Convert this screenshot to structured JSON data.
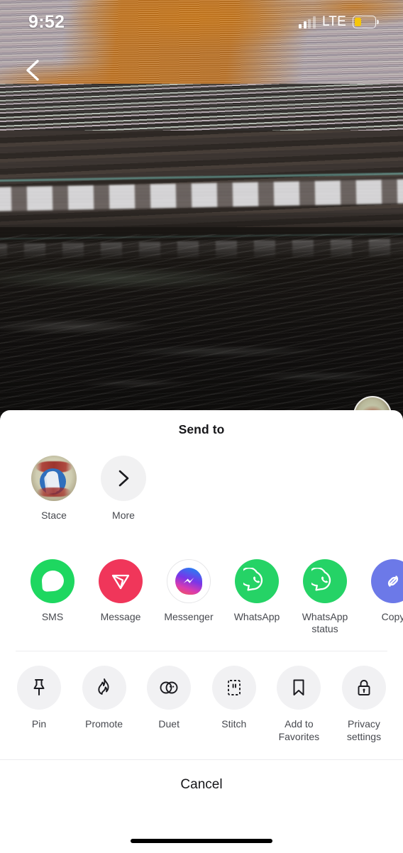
{
  "status_bar": {
    "time": "9:52",
    "network": "LTE",
    "signal_icon": "signal-bars-icon",
    "battery_icon": "battery-low-power-icon",
    "battery_fill_color": "#F5C60A",
    "signal_bars_filled": 2,
    "signal_bars_total": 4
  },
  "video": {
    "back_icon": "chevron-left-icon",
    "creator_avatar": "creator-avatar"
  },
  "sheet": {
    "title": "Send to",
    "contacts": [
      {
        "label": "Stace",
        "avatar": "thumbs-up-logo-avatar"
      },
      {
        "label": "More",
        "icon": "chevron-right-icon"
      }
    ],
    "apps": [
      {
        "label": "SMS",
        "icon": "sms-icon",
        "color": "#1ED760"
      },
      {
        "label": "Message",
        "icon": "tiktok-direct-message-icon",
        "color": "#F0365A"
      },
      {
        "label": "Messenger",
        "icon": "messenger-icon",
        "color": "#FFFFFF"
      },
      {
        "label": "WhatsApp",
        "icon": "whatsapp-icon",
        "color": "#25D366"
      },
      {
        "label": "WhatsApp status",
        "icon": "whatsapp-status-icon",
        "color": "#25D366"
      },
      {
        "label": "Copy",
        "icon": "copy-link-icon",
        "color": "#6C79E8"
      }
    ],
    "actions": [
      {
        "label": "Pin",
        "icon": "pin-icon"
      },
      {
        "label": "Promote",
        "icon": "flame-icon"
      },
      {
        "label": "Duet",
        "icon": "duet-circles-icon"
      },
      {
        "label": "Stitch",
        "icon": "stitch-icon"
      },
      {
        "label": "Add to Favorites",
        "icon": "bookmark-icon"
      },
      {
        "label": "Privacy settings",
        "icon": "lock-icon"
      }
    ],
    "cancel_label": "Cancel"
  }
}
